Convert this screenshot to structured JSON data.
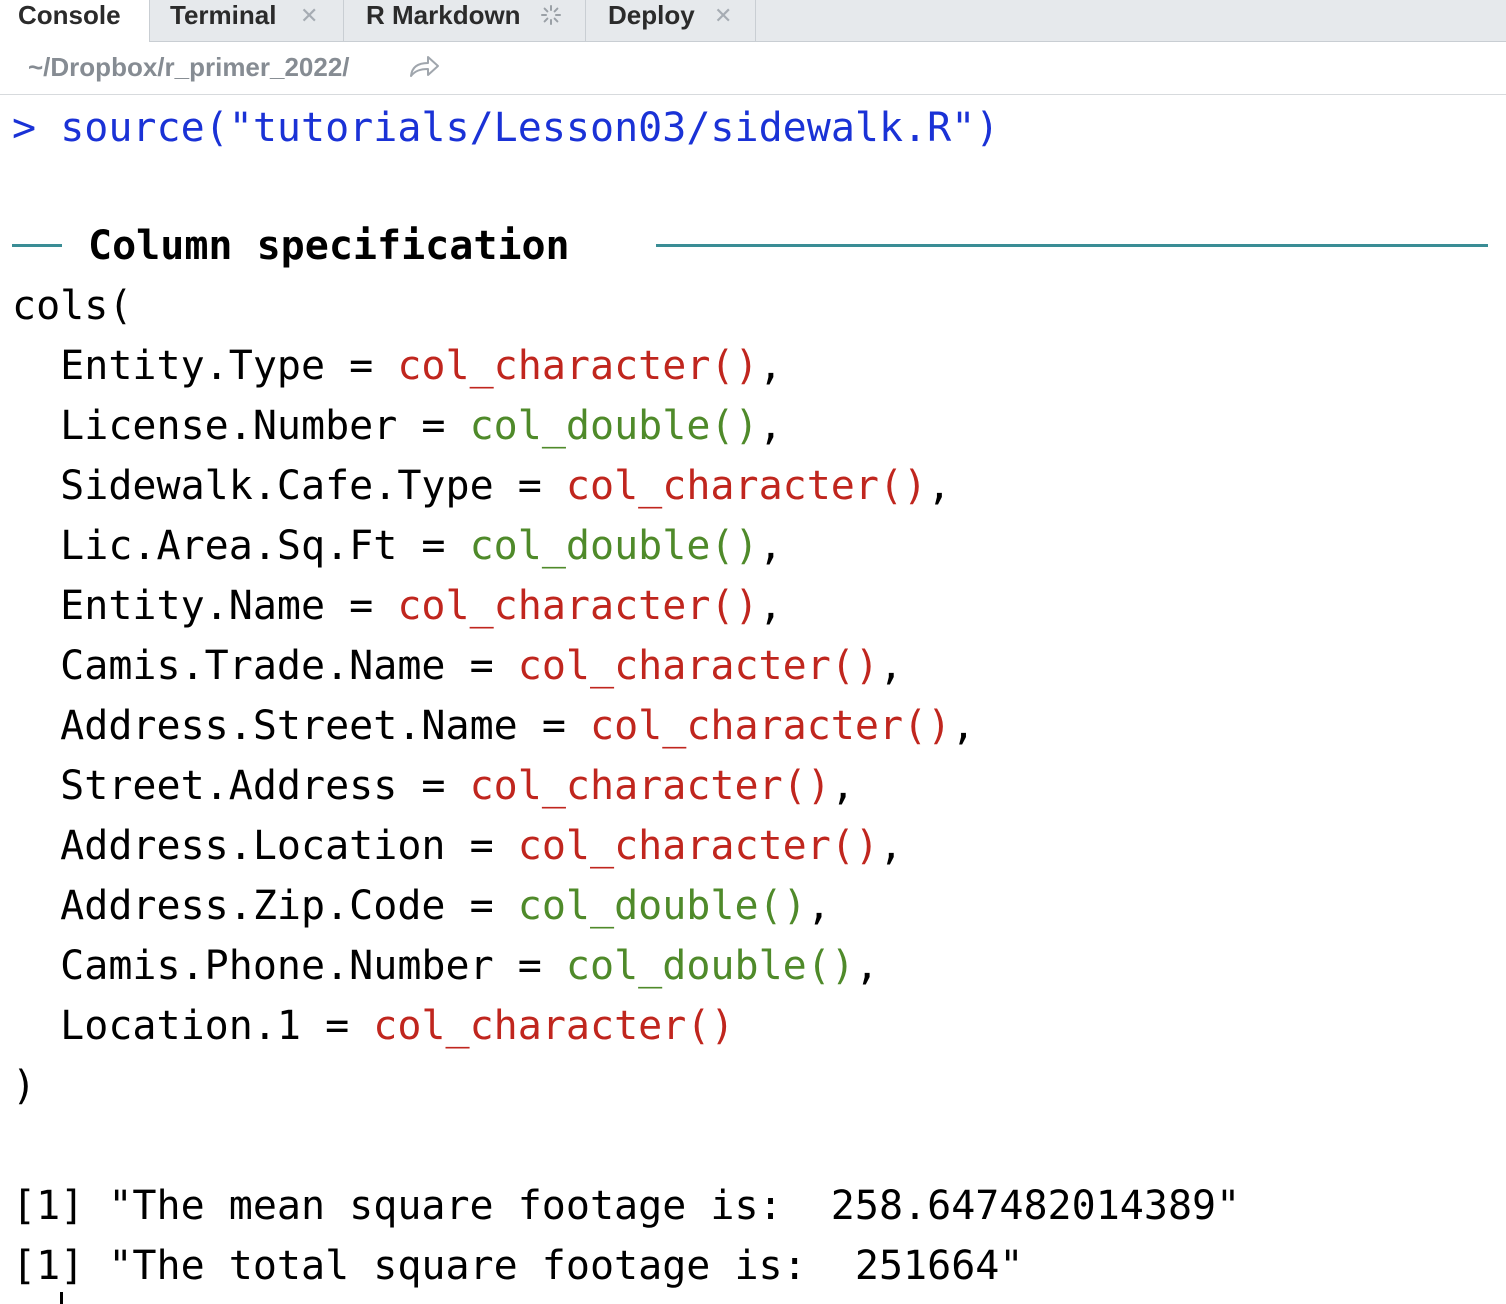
{
  "tabs": [
    {
      "label": "Console",
      "active": true,
      "closable": false
    },
    {
      "label": "Terminal",
      "active": false,
      "closable": true
    },
    {
      "label": "R Markdown",
      "active": false,
      "busy": true
    },
    {
      "label": "Deploy",
      "active": false,
      "closable": true
    }
  ],
  "path": {
    "text": "~/Dropbox/r_primer_2022/",
    "icon": "go-to-directory-icon"
  },
  "console": {
    "prompt": ">",
    "command": "source(\"tutorials/Lesson03/sidewalk.R\")",
    "spec_header": "Column specification",
    "cols_open": "cols(",
    "cols_close": ")",
    "specs": [
      {
        "name": "Entity.Type",
        "type": "col_character()",
        "sep": ","
      },
      {
        "name": "License.Number",
        "type": "col_double()",
        "sep": ","
      },
      {
        "name": "Sidewalk.Cafe.Type",
        "type": "col_character()",
        "sep": ","
      },
      {
        "name": "Lic.Area.Sq.Ft",
        "type": "col_double()",
        "sep": ","
      },
      {
        "name": "Entity.Name",
        "type": "col_character()",
        "sep": ","
      },
      {
        "name": "Camis.Trade.Name",
        "type": "col_character()",
        "sep": ","
      },
      {
        "name": "Address.Street.Name",
        "type": "col_character()",
        "sep": ","
      },
      {
        "name": "Street.Address",
        "type": "col_character()",
        "sep": ","
      },
      {
        "name": "Address.Location",
        "type": "col_character()",
        "sep": ","
      },
      {
        "name": "Address.Zip.Code",
        "type": "col_double()",
        "sep": ","
      },
      {
        "name": "Camis.Phone.Number",
        "type": "col_double()",
        "sep": ","
      },
      {
        "name": "Location.1",
        "type": "col_character()",
        "sep": ""
      }
    ],
    "output": [
      "[1] \"The mean square footage is:  258.647482014389\"",
      "[1] \"The total square footage is:  251664\""
    ]
  },
  "colors": {
    "command": "#1a32d6",
    "character_type": "#c0261e",
    "double_type": "#4f8a2a",
    "rule": "#3a8d95"
  }
}
